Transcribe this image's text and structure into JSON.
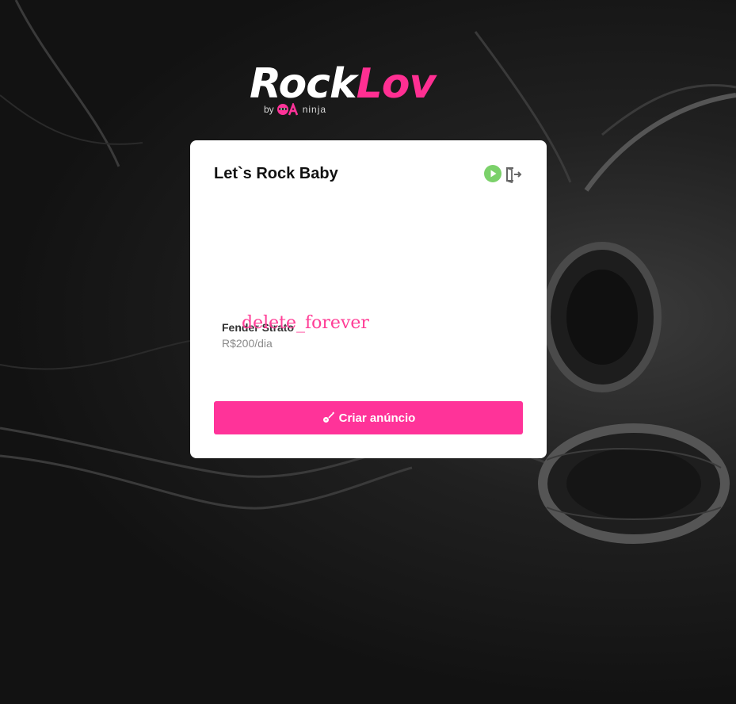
{
  "logo": {
    "word_white": "Rock",
    "word_pink": "Lov",
    "by": "by",
    "brand": "ninja"
  },
  "card": {
    "title": "Let`s Rock Baby",
    "icons": [
      "play-circle-icon",
      "logout-icon"
    ],
    "equipos": [
      {
        "name": "Fender Strato",
        "price": "R$200/dia",
        "action": "delete_forever"
      }
    ],
    "create_button": "Criar anúncio"
  },
  "colors": {
    "accent": "#ff3399",
    "play": "#7bd16a",
    "background": "#151515"
  }
}
